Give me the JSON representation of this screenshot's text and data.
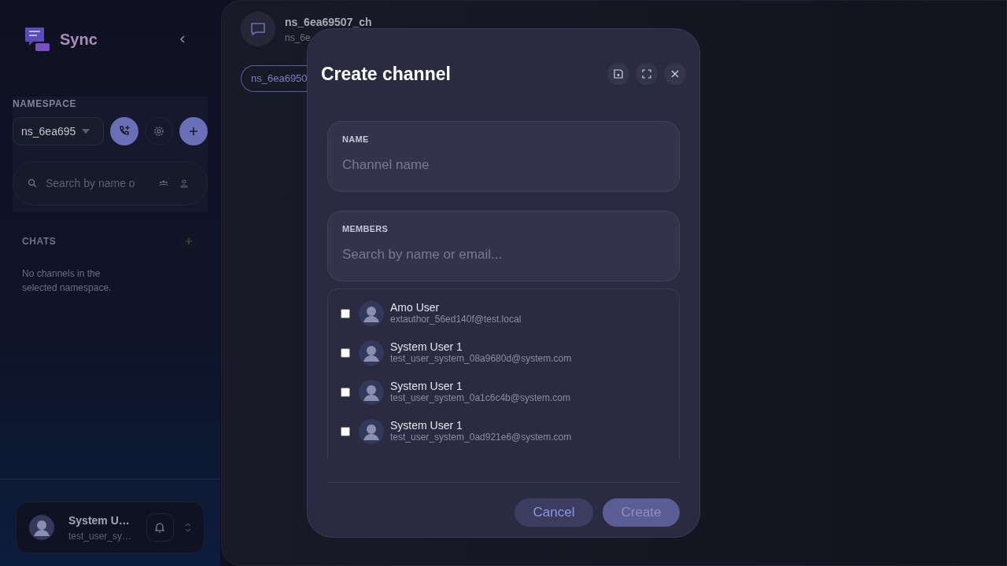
{
  "sidebar": {
    "app_name": "Sync",
    "namespace_label": "NAMESPACE",
    "namespace_select": "ns_6ea695",
    "search_placeholder": "Search by name o",
    "chats_label": "CHATS",
    "empty_message": "No channels in the selected namespace.",
    "user": {
      "name": "System U…",
      "email": "test_user_sy…"
    }
  },
  "main": {
    "title": "ns_6ea69507_ch",
    "subtitle": "ns_6e",
    "chip": "ns_6ea6950"
  },
  "dialog": {
    "title": "Create channel",
    "name_label": "NAME",
    "name_placeholder": "Channel name",
    "members_label": "MEMBERS",
    "members_placeholder": "Search by name or email...",
    "members": [
      {
        "name": "Amo User",
        "email": "extauthor_56ed140f@test.local",
        "checked": false
      },
      {
        "name": "System User 1",
        "email": "test_user_system_08a9680d@system.com",
        "checked": false
      },
      {
        "name": "System User 1",
        "email": "test_user_system_0a1c6c4b@system.com",
        "checked": false
      },
      {
        "name": "System User 1",
        "email": "test_user_system_0ad921e6@system.com",
        "checked": false
      }
    ],
    "cancel": "Cancel",
    "create": "Create",
    "create_disabled": true
  }
}
